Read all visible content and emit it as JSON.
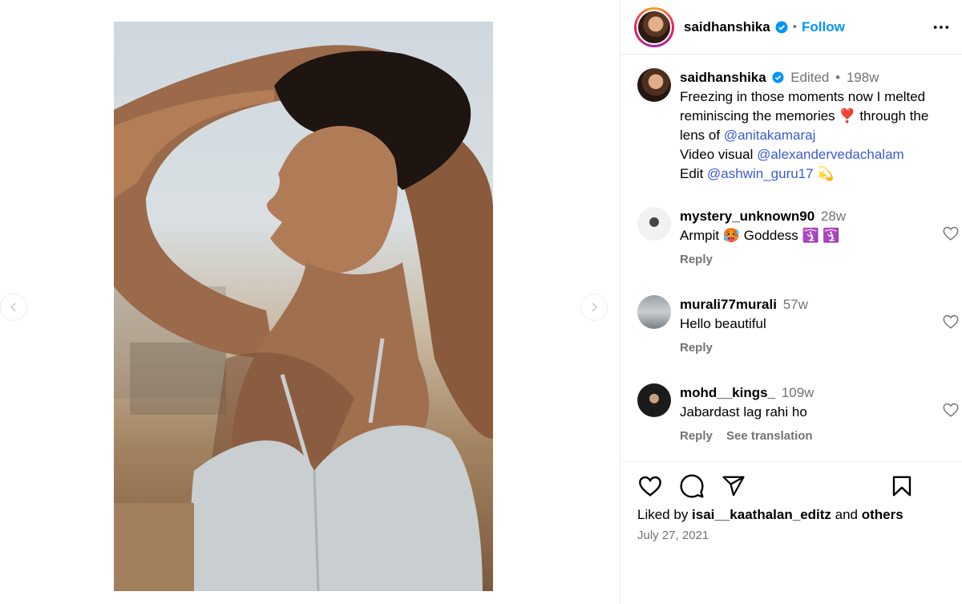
{
  "header": {
    "username": "saidhanshika",
    "follow_label": "Follow",
    "separator": "•"
  },
  "caption": {
    "username": "saidhanshika",
    "edited_label": "Edited",
    "separator": "•",
    "age": "198w",
    "line1": "Freezing in those moments now I melted reminiscing the memories",
    "line1_emoji": "❣️",
    "line1_tail": " through the lens of ",
    "mention1": "@anitakamaraj",
    "line2_prefix": "Video visual ",
    "mention2": "@alexandervedachalam",
    "line3_prefix": "Edit ",
    "mention3": "@ashwin_guru17",
    "line3_emoji": "💫"
  },
  "comments": [
    {
      "username": "mystery_unknown90",
      "age": "28w",
      "text": "Armpit 🥵 Goddess 🛐 🛐",
      "reply_label": "Reply",
      "translate_label": ""
    },
    {
      "username": "murali77murali",
      "age": "57w",
      "text": "Hello beautiful",
      "reply_label": "Reply",
      "translate_label": ""
    },
    {
      "username": "mohd__kings_",
      "age": "109w",
      "text": "Jabardast lag rahi ho",
      "reply_label": "Reply",
      "translate_label": "See translation"
    }
  ],
  "actions": {
    "icons": [
      "heart-icon",
      "comment-icon",
      "share-icon",
      "bookmark-icon"
    ],
    "liked_by_prefix": "Liked by ",
    "liked_by_user": "isai__kaathalan_editz",
    "liked_by_and": " and ",
    "liked_by_others": "others",
    "date": "July 27, 2021"
  },
  "colors": {
    "accent": "#0095f6",
    "mention": "#3a5bcf",
    "muted": "#737373",
    "verified": "#0095f6"
  }
}
